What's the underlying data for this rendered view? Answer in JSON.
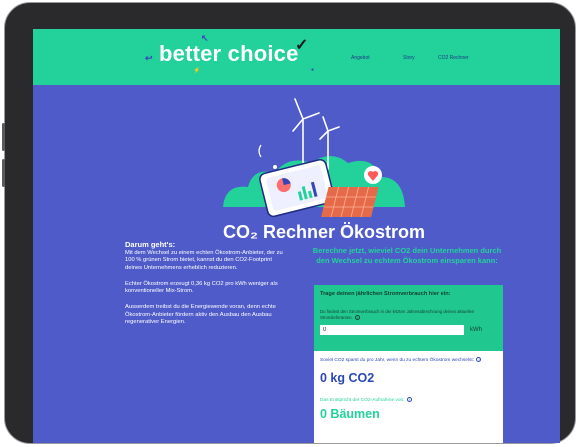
{
  "header": {
    "logo_text": "better choice",
    "nav": [
      "Angebot",
      "Story",
      "CO2 Rechner"
    ]
  },
  "page": {
    "title": "CO₂ Rechner Ökostrom"
  },
  "left": {
    "heading": "Darum geht's:",
    "paragraphs": [
      "Mit dem Wechsel zu einem echten Ökostrom-Anbieter, der zu 100 % grünen Strom bietet, kannst du den CO2-Footprint deines Unternehmens erheblich reduzieren.",
      "Echter Ökostrom erzeugt 0,36 kg CO2 pro kWh weniger als konventioneller Mix-Strom.",
      "Ausserdem treibst du die Energiewende voran, denn echte Ökostrom-Anbieter fördern aktiv den Ausbau den Ausbau regenerativer Energien."
    ]
  },
  "right": {
    "heading": "Berechne jetzt, wieviel CO2 dein Unternehmen durch den Wechsel zu echtem Ökostrom einsparen kann:",
    "card_title": "Trage deinen jährlichen Stromverbrauch hier ein:",
    "input_label": "Du findest den Stromverbrauch in der letzten Jahresabrechnung deines aktuellen Stromlieferanten.",
    "input_value": "0",
    "input_unit": "kWh",
    "result_label": "Soviel CO2 sparst du pro Jahr, wenn du zu echtem Ökostrom wechselst:",
    "result_value": "0 kg CO2",
    "trees_label": "Das Entspricht der CO2-Aufnahme von:",
    "trees_value": "0 Bäumen"
  },
  "colors": {
    "accent_green": "#22d29a",
    "background_blue": "#4f5bc9",
    "text_blue": "#2a47b8"
  }
}
